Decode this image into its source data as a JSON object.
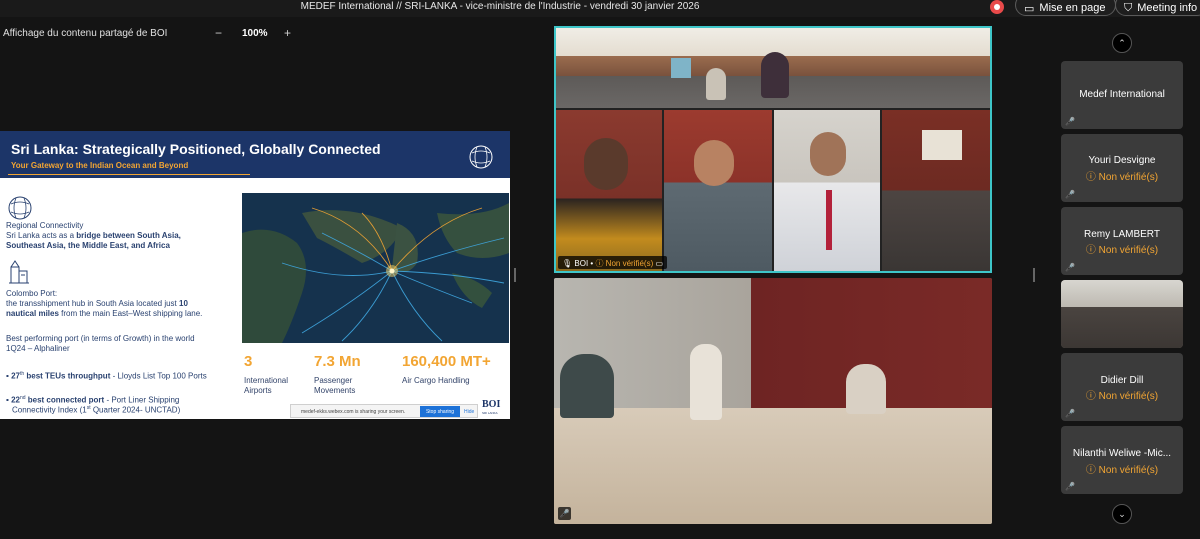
{
  "topbar": {
    "meeting_title": "MEDEF International // SRI-LANKA - vice-ministre de l'Industrie - vendredi 30 janvier 2026",
    "layout_button": "Mise en page",
    "meeting_info_button": "Meeting info"
  },
  "share": {
    "label": "Affichage du contenu partagé de BOI",
    "zoom_out": "−",
    "zoom_value": "100%",
    "zoom_in": "+"
  },
  "slide": {
    "title": "Sri Lanka: Strategically Positioned, Globally Connected",
    "subtitle": "Your Gateway to the Indian Ocean and Beyond",
    "regional_heading": "Regional Connectivity",
    "regional_text_a": "Sri Lanka acts as a ",
    "regional_text_b": "bridge between South Asia,",
    "regional_text_c": "Southeast Asia, the Middle East, and Africa",
    "port_heading": "Colombo Port:",
    "port_text_a": "the transshipment hub in South Asia located just ",
    "port_text_b": "10",
    "port_text_c": "nautical miles",
    "port_text_d": " from the main East–West shipping lane.",
    "growth_a": "Best performing port (in terms of Growth) in the world",
    "growth_b": "1Q24 – Alphaliner",
    "teu_rank": "27",
    "teu_sup": "th",
    "teu_bold": " best TEUs throughput",
    "teu_rest": " - Lloyds List Top 100 Ports",
    "conn_rank": "22",
    "conn_sup": "nd",
    "conn_bold": " best connected port",
    "conn_rest": " - Port Liner Shipping",
    "conn_line2_a": "Connectivity Index (1",
    "conn_line2_sup": "st",
    "conn_line2_b": " Quarter 2024- UNCTAD)",
    "stats": [
      {
        "value": "3",
        "label_a": "International",
        "label_b": "Airports"
      },
      {
        "value": "7.3 Mn",
        "label_a": "Passenger",
        "label_b": "Movements"
      },
      {
        "value": "160,400 MT+",
        "label_a": "Air Cargo Handling",
        "label_b": ""
      }
    ],
    "sharing_text": "medef-ekks.webex.com is sharing your screen.",
    "stop_sharing": "Stop sharing",
    "hide": "Hide",
    "logo": "BOI",
    "logo_sub": "SRI LANKA"
  },
  "video_top": {
    "badge_name": "BOI •",
    "badge_status": "Non vérifié(s)"
  },
  "participants": [
    {
      "name": "Medef International",
      "status": ""
    },
    {
      "name": "Youri Desvigne",
      "status": "Non vérifié(s)"
    },
    {
      "name": "Remy LAMBERT",
      "status": "Non vérifié(s)"
    },
    {
      "name": "",
      "status": ""
    },
    {
      "name": "Didier Dill",
      "status": "Non vérifié(s)"
    },
    {
      "name": "Nilanthi Weliwe -Mic...",
      "status": "Non vérifié(s)"
    }
  ],
  "colors": {
    "accent_teal": "#3ec6c9",
    "slide_navy": "#1c3568",
    "slide_orange": "#f2a533",
    "unverified": "#f2a533",
    "muted_red": "#e55555"
  }
}
